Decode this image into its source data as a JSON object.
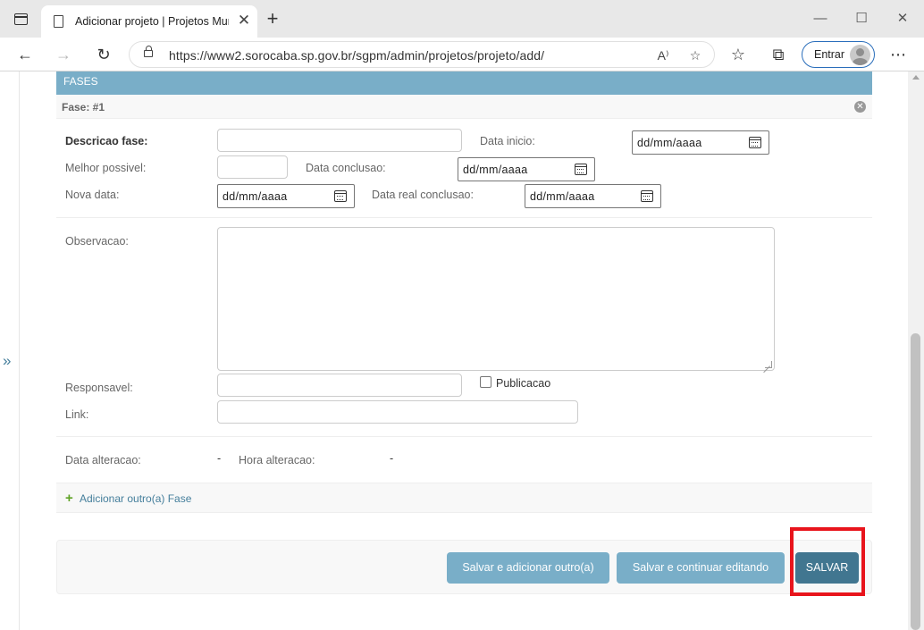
{
  "browser": {
    "tab_title": "Adicionar projeto | Projetos Municipais",
    "url": "https://www2.sorocaba.sp.gov.br/sgpm/admin/projetos/projeto/add/",
    "signin_label": "Entrar",
    "icons": [
      "window-icon",
      "doc-icon",
      "close-icon",
      "plus-icon",
      "minimize-icon",
      "maximize-icon",
      "back-arrow-icon",
      "forward-arrow-icon",
      "refresh-icon",
      "lock-icon",
      "read-aloud-icon",
      "add-favorite-icon",
      "favorites-icon",
      "collections-icon",
      "avatar-icon",
      "more-icon"
    ]
  },
  "nav": {
    "expand_symbol": "»"
  },
  "fases": {
    "header": "FASES",
    "fase_title": "Fase: #1",
    "fields": {
      "descricao_label": "Descricao fase:",
      "data_inicio_label": "Data inicio:",
      "melhor_possivel_label": "Melhor possivel:",
      "data_conclusao_label": "Data conclusao:",
      "nova_data_label": "Nova data:",
      "data_real_conclusao_label": "Data real conclusao:",
      "observacao_label": "Observacao:",
      "responsavel_label": "Responsavel:",
      "publicacao_label": "Publicacao",
      "link_label": "Link:",
      "data_alteracao_label": "Data alteracao:",
      "data_alteracao_value": "-",
      "hora_alteracao_label": "Hora alteracao:",
      "hora_alteracao_value": "-"
    },
    "date_placeholder": "dd/mm/aaaa",
    "add_another": "Adicionar outro(a) Fase"
  },
  "submit": {
    "save_add_another": "Salvar e adicionar outro(a)",
    "save_continue": "Salvar e continuar editando",
    "save": "SALVAR"
  },
  "colors": {
    "module_header": "#79aec8",
    "primary_button": "#417690",
    "secondary_button": "#79aec8",
    "highlight": "#e8141c",
    "add_icon": "#5fa225",
    "link": "#447e9b"
  }
}
